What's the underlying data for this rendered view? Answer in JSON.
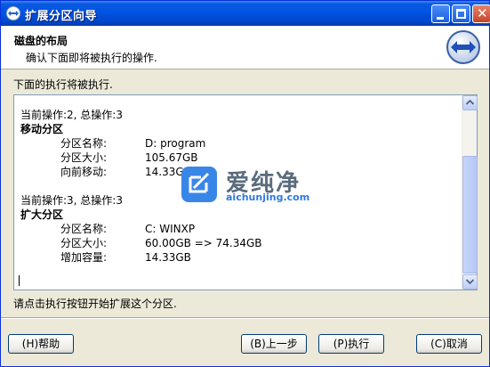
{
  "window": {
    "title": "扩展分区向导",
    "min_icon": "minimize-icon",
    "max_icon": "maximize-icon",
    "close_icon": "close-icon"
  },
  "header": {
    "title": "磁盘的布局",
    "subtitle": "确认下面即将被执行的操作.",
    "icon": "resize-arrows-icon"
  },
  "intro": "下面的执行将被执行.",
  "operations": [
    {
      "progress": "当前操作:2, 总操作:3",
      "heading": "移动分区",
      "rows": [
        {
          "label": "分区名称:",
          "value": "D: program"
        },
        {
          "label": "分区大小:",
          "value": "105.67GB"
        },
        {
          "label": "向前移动:",
          "value": "14.33GB"
        }
      ]
    },
    {
      "progress": "当前操作:3, 总操作:3",
      "heading": "扩大分区",
      "rows": [
        {
          "label": "分区名称:",
          "value": "C: WINXP"
        },
        {
          "label": "分区大小:",
          "value": "60.00GB => 74.34GB"
        },
        {
          "label": "增加容量:",
          "value": "14.33GB"
        }
      ]
    }
  ],
  "hint": "请点击执行按钮开始扩展这个分区.",
  "buttons": {
    "help": "(H)帮助",
    "back": "(B)上一步",
    "run": "(P)执行",
    "cancel": "(C)取消"
  },
  "watermark": {
    "title": "爱纯净",
    "url": "aichunjing.com"
  },
  "colors": {
    "titlebar": "#0054e3",
    "accent": "#3a86e8"
  }
}
